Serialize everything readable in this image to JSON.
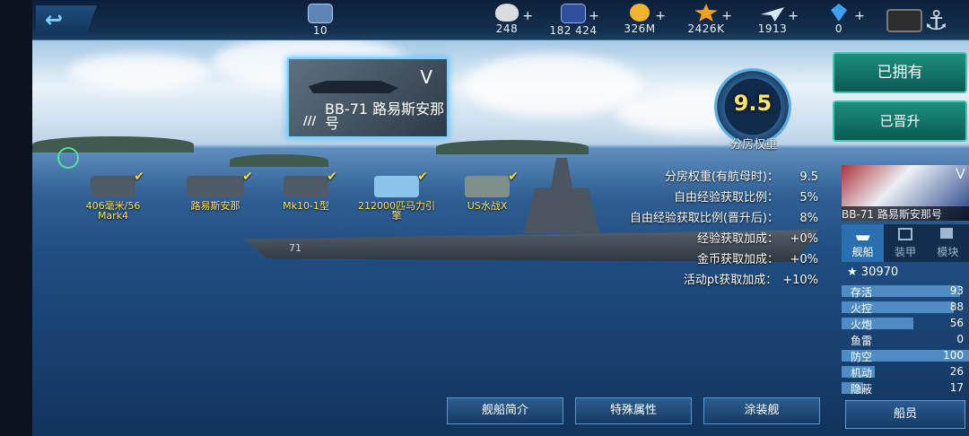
{
  "topbar": {
    "rank_value": "10",
    "resources": [
      {
        "icon": "heart-icon",
        "value": "248"
      },
      {
        "icon": "card-icon",
        "value": "182 424"
      },
      {
        "icon": "coin-icon",
        "value": "326M"
      },
      {
        "icon": "star-icon",
        "value": "2426K"
      },
      {
        "icon": "plane-icon",
        "value": "1913"
      },
      {
        "icon": "gem-icon",
        "value": "0"
      }
    ],
    "plus": "+"
  },
  "ship_card": {
    "tier": "V",
    "name": "BB-71 路易斯安那号",
    "tag": "///"
  },
  "weight": {
    "value": "9.5",
    "label": "分房权重"
  },
  "stats": [
    {
      "label": "分房权重(有航母时)：",
      "value": "9.5"
    },
    {
      "label": "自由经验获取比例：",
      "value": "5%"
    },
    {
      "label": "自由经验获取比例(晋升后)：",
      "value": "8%"
    },
    {
      "label": "经验获取加成：",
      "value": "+0%"
    },
    {
      "label": "金币获取加成：",
      "value": "+0%"
    },
    {
      "label": "活动pt获取加成：",
      "value": "+10%"
    }
  ],
  "equipment": [
    {
      "label": "406毫米/56 Mark4"
    },
    {
      "label": "路易斯安那"
    },
    {
      "label": "Mk10-1型"
    },
    {
      "label": "212000匹马力引擎"
    },
    {
      "label": "US水战X"
    }
  ],
  "hull_number": "71",
  "right_panel": {
    "owned_button": "已拥有",
    "promoted_button": "已晋升",
    "ship_name": "BB-71 路易斯安那号",
    "tier": "V",
    "tabs": [
      "舰船",
      "装甲",
      "模块"
    ],
    "score": "30970",
    "attributes": [
      {
        "label": "存活",
        "value": "93",
        "level": 0.93
      },
      {
        "label": "火控",
        "value": "88",
        "level": 0.88
      },
      {
        "label": "火炮",
        "value": "56",
        "level": 0.56
      },
      {
        "label": "鱼雷",
        "value": "0",
        "level": 0
      },
      {
        "label": "防空",
        "value": "100",
        "level": 1.0
      },
      {
        "label": "机动",
        "value": "26",
        "level": 0.26
      },
      {
        "label": "隐蔽",
        "value": "17",
        "level": 0.17
      }
    ],
    "crew_button": "船员"
  },
  "bottom_buttons": {
    "intro": "舰船简介",
    "special": "特殊属性",
    "paint": "涂装舰"
  },
  "colors": {
    "accent_green": "#1d8f7e",
    "equip_yellow": "#ffe15a",
    "weight_yellow": "#ffe36b",
    "attr_bar": "#4f8cc4"
  }
}
